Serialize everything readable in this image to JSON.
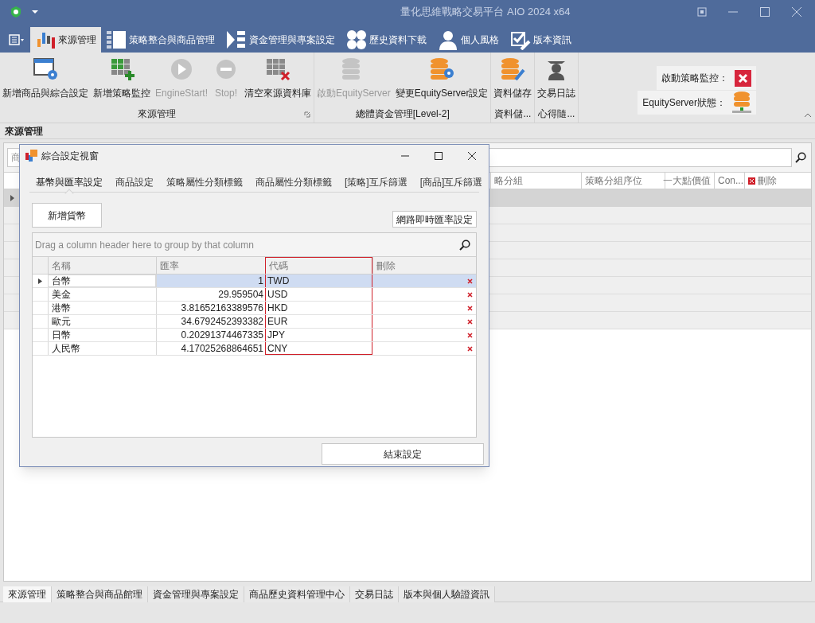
{
  "window": {
    "title": "量化思維戰略交易平台 AIO 2024 x64"
  },
  "ribbon_tabs": [
    {
      "label": "來源管理",
      "kind": "bars",
      "selected": true
    },
    {
      "label": "策略整合與商品管理",
      "kind": "grid",
      "selected": false
    },
    {
      "label": "資金管理與專案設定",
      "kind": "flow",
      "selected": false
    },
    {
      "label": "歷史資料下載",
      "kind": "circles",
      "selected": false
    },
    {
      "label": "個人風格",
      "kind": "person",
      "selected": false
    },
    {
      "label": "版本資訊",
      "kind": "check",
      "selected": false
    }
  ],
  "ribbon_groups": [
    {
      "label": "來源管理",
      "launcher": true,
      "items": [
        {
          "label": "新增商品與綜合設定",
          "kind": "window-gear",
          "disabled": false
        },
        {
          "label": "新增策略監控",
          "kind": "grid-add",
          "disabled": false
        },
        {
          "label": "EngineStart!",
          "kind": "play",
          "disabled": true
        },
        {
          "label": "Stop!",
          "kind": "stop",
          "disabled": true
        },
        {
          "label": "清空來源資料庫",
          "kind": "grid-delete",
          "disabled": false
        }
      ]
    },
    {
      "label": "總體資金管理[Level-2]",
      "launcher": false,
      "items": [
        {
          "label": "啟動EquityServer",
          "kind": "database",
          "disabled": true
        },
        {
          "label": "變更EquityServer設定",
          "kind": "database-gear",
          "disabled": false
        }
      ]
    },
    {
      "label": "資料儲...",
      "launcher": false,
      "items": [
        {
          "label": "資料儲存",
          "kind": "database-edit",
          "disabled": false
        }
      ]
    },
    {
      "label": "心得隨...",
      "launcher": false,
      "items": [
        {
          "label": "交易日誌",
          "kind": "graduate",
          "disabled": false
        }
      ]
    }
  ],
  "status_panel": [
    {
      "label": "啟動策略監控：",
      "kind": "stopped"
    },
    {
      "label": "EquityServer狀態：",
      "kind": "server"
    }
  ],
  "panel_title": "來源管理",
  "main_grid": {
    "search_placeholder": "商",
    "columns": [
      "略分組",
      "策略分組序位",
      "一大點價值",
      "Con...",
      "刪除"
    ]
  },
  "dialog": {
    "title": "綜合設定視窗",
    "tabs": [
      {
        "label": "基幣與匯率設定",
        "selected": true
      },
      {
        "label": "商品設定",
        "selected": false
      },
      {
        "label": "策略屬性分類標籤",
        "selected": false
      },
      {
        "label": "商品屬性分類標籤",
        "selected": false
      },
      {
        "label": "[策略]互斥篩選",
        "selected": false
      },
      {
        "label": "[商品]互斥篩選",
        "selected": false
      }
    ],
    "add_button": "新增貨幣",
    "rate_button": "網路即時匯率設定",
    "group_hint": "Drag a column header here to group by that column",
    "columns": [
      {
        "label": "名稱",
        "highlighted": false
      },
      {
        "label": "匯率",
        "highlighted": false
      },
      {
        "label": "代碼",
        "highlighted": true
      },
      {
        "label": "刪除",
        "highlighted": false
      }
    ],
    "rows": [
      {
        "name": "台幣",
        "rate": "1",
        "code": "TWD",
        "selected": true
      },
      {
        "name": "美金",
        "rate": "29.959504",
        "code": "USD",
        "selected": false
      },
      {
        "name": "港幣",
        "rate": "3.81652163389576",
        "code": "HKD",
        "selected": false
      },
      {
        "name": "歐元",
        "rate": "34.6792452393382",
        "code": "EUR",
        "selected": false
      },
      {
        "name": "日幣",
        "rate": "0.20291374467335",
        "code": "JPY",
        "selected": false
      },
      {
        "name": "人民幣",
        "rate": "4.17025268864651",
        "code": "CNY",
        "selected": false
      }
    ],
    "finish_button": "結束設定"
  },
  "bottom_tabs": [
    {
      "label": "來源管理",
      "selected": true
    },
    {
      "label": "策略整合與商品館理",
      "selected": false
    },
    {
      "label": "資金管理與專案設定",
      "selected": false
    },
    {
      "label": "商品歷史資料管理中心",
      "selected": false
    },
    {
      "label": "交易日誌",
      "selected": false
    },
    {
      "label": "版本與個人驗證資訊",
      "selected": false
    }
  ]
}
